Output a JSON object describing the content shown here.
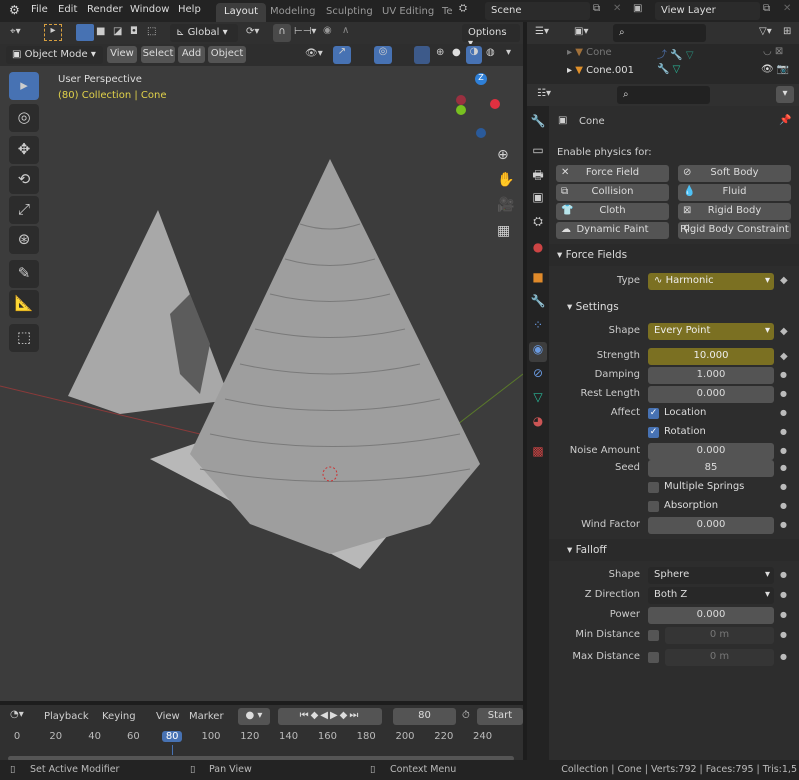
{
  "topbar": {
    "menus": [
      "File",
      "Edit",
      "Render",
      "Window",
      "Help"
    ],
    "workspaces": [
      "Layout",
      "Modeling",
      "Sculpting",
      "UV Editing",
      "Te"
    ],
    "scene": "Scene",
    "view_layer": "View Layer"
  },
  "tool_settings": {
    "orientation": "Global",
    "options": "Options"
  },
  "viewport_header": {
    "mode": "Object Mode",
    "menus": [
      "View",
      "Select",
      "Add",
      "Object"
    ]
  },
  "viewport": {
    "title": "User Perspective",
    "subtitle": "(80) Collection | Cone",
    "accent": "#e1d24a"
  },
  "outliner": {
    "items": [
      {
        "name": "Cone",
        "dim": true
      },
      {
        "name": "Cone.001",
        "dim": false
      }
    ]
  },
  "properties": {
    "object_name": "Cone",
    "enable_physics_label": "Enable physics for:",
    "physics_buttons": [
      [
        "Force Field",
        "Soft Body"
      ],
      [
        "Collision",
        "Fluid"
      ],
      [
        "Cloth",
        "Rigid Body"
      ],
      [
        "Dynamic Paint",
        "Rigid Body Constraint"
      ]
    ],
    "force_fields_header": "Force Fields",
    "type_label": "Type",
    "type_value": "Harmonic",
    "settings_header": "Settings",
    "rows": [
      {
        "label": "Shape",
        "value": "Every Point",
        "kind": "yellowsel"
      },
      {
        "label": "Strength",
        "value": "10.000",
        "kind": "yellow"
      },
      {
        "label": "Damping",
        "value": "1.000",
        "kind": "num"
      },
      {
        "label": "Rest Length",
        "value": "0.000",
        "kind": "num"
      },
      {
        "label": "Affect",
        "value": "Location",
        "kind": "check",
        "checked": true
      },
      {
        "label": "",
        "value": "Rotation",
        "kind": "check",
        "checked": true
      },
      {
        "label": "Noise Amount",
        "value": "0.000",
        "kind": "num"
      },
      {
        "label": "Seed",
        "value": "85",
        "kind": "num"
      },
      {
        "label": "",
        "value": "Multiple Springs",
        "kind": "check",
        "checked": false
      },
      {
        "label": "",
        "value": "Absorption",
        "kind": "check",
        "checked": false
      },
      {
        "label": "Wind Factor",
        "value": "0.000",
        "kind": "num"
      }
    ],
    "falloff_header": "Falloff",
    "falloff_rows": [
      {
        "label": "Shape",
        "value": "Sphere",
        "kind": "sel"
      },
      {
        "label": "Z Direction",
        "value": "Both Z",
        "kind": "sel"
      },
      {
        "label": "Power",
        "value": "0.000",
        "kind": "num"
      },
      {
        "label": "Min Distance",
        "value": "0 m",
        "kind": "dis"
      },
      {
        "label": "Max Distance",
        "value": "0 m",
        "kind": "dis"
      }
    ]
  },
  "timeline": {
    "menus": [
      "Playback",
      "Keying",
      "View",
      "Marker"
    ],
    "current_frame": "80",
    "start_label": "Start",
    "ticks": [
      "0",
      "20",
      "40",
      "60",
      "80",
      "100",
      "120",
      "140",
      "160",
      "180",
      "200",
      "220",
      "240"
    ]
  },
  "status": {
    "hint1": "Set Active Modifier",
    "hint2": "Pan View",
    "hint3": "Context Menu",
    "stats": "Collection | Cone | Verts:792 | Faces:795 | Tris:1,5"
  }
}
